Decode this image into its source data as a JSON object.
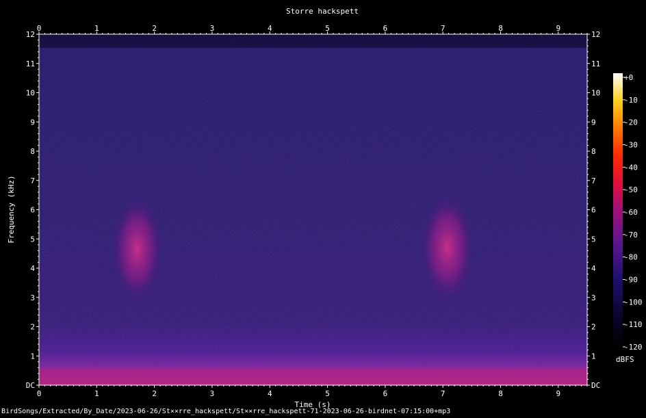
{
  "chart_data": {
    "type": "heatmap",
    "title": "Storre hackspett",
    "xlabel": "Time (s)",
    "ylabel": "Frequency (kHz)",
    "x_ticks": [
      "0",
      "1",
      "2",
      "3",
      "4",
      "5",
      "6",
      "7",
      "8",
      "9"
    ],
    "y_ticks": [
      "DC",
      "1",
      "2",
      "3",
      "4",
      "5",
      "6",
      "7",
      "8",
      "9",
      "10",
      "11",
      "12"
    ],
    "xlim": [
      0,
      9.5
    ],
    "ylim": [
      0,
      12
    ],
    "colorbar": {
      "label": "dBFS",
      "ticks": [
        "+0",
        "-10",
        "-20",
        "-30",
        "-40",
        "-50",
        "-60",
        "-70",
        "-80",
        "-90",
        "-100",
        "-110",
        "-120"
      ],
      "range": [
        -120,
        0
      ]
    },
    "energy_regions": [
      {
        "t_start": 1.25,
        "t_end": 2.15,
        "f_low": 2.8,
        "f_high": 6.5,
        "level_dbfs": -72
      },
      {
        "t_start": 6.6,
        "t_end": 7.55,
        "f_low": 2.8,
        "f_high": 6.6,
        "level_dbfs": -72
      },
      {
        "t_start": 0.0,
        "t_end": 9.5,
        "f_low": 0.0,
        "f_high": 0.6,
        "level_dbfs": -68
      }
    ]
  },
  "footer": {
    "path": "BirdSongs/Extracted/By_Date/2023-06-26/St××rre_hackspett/St××rre_hackspett-71-2023-06-26-birdnet-07:15:00+mp3"
  }
}
